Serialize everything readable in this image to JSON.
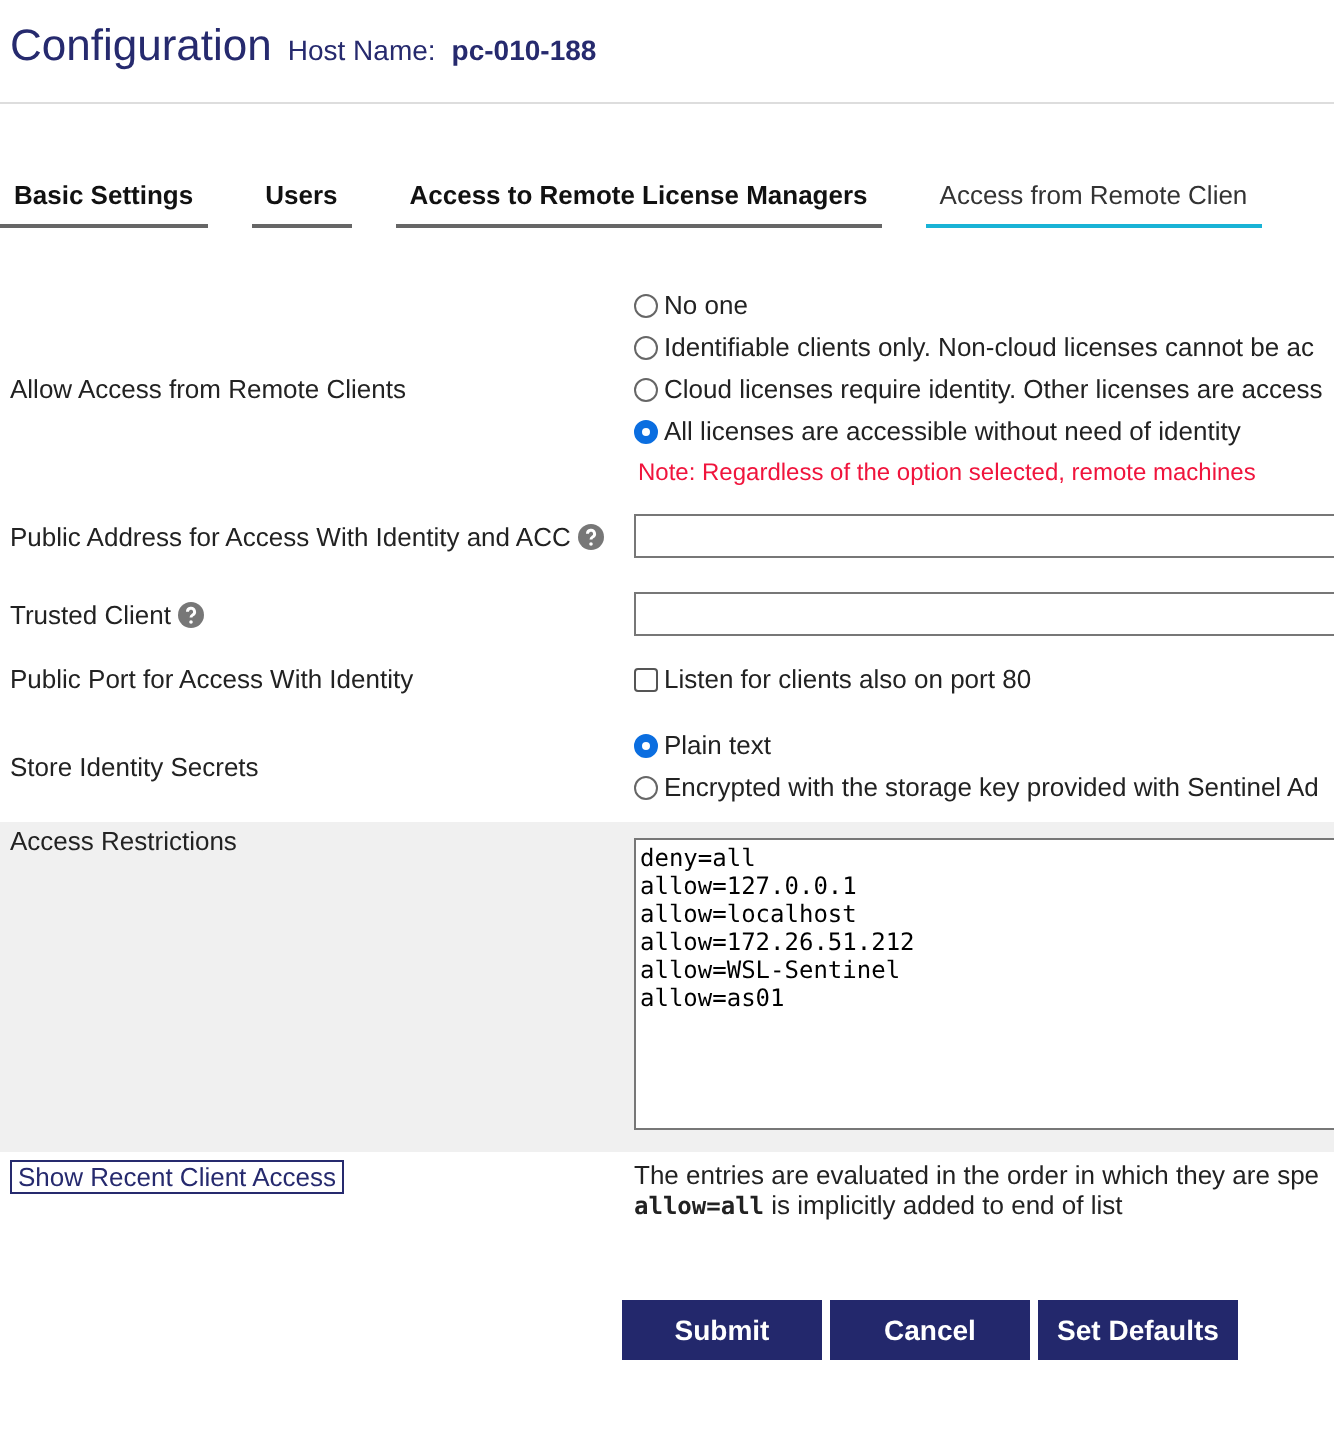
{
  "header": {
    "title": "Configuration",
    "host_label": "Host Name:",
    "host_name": "pc-010-188"
  },
  "tabs": [
    {
      "label": "Basic Settings",
      "selected": false
    },
    {
      "label": "Users",
      "selected": false
    },
    {
      "label": "Access to Remote License Managers",
      "selected": false
    },
    {
      "label": "Access from Remote Clien",
      "selected": true
    }
  ],
  "allow_access": {
    "label": "Allow Access from Remote Clients",
    "options": [
      {
        "label": "No one",
        "selected": false
      },
      {
        "label": "Identifiable clients only. Non-cloud licenses cannot be ac",
        "selected": false
      },
      {
        "label": "Cloud licenses require identity. Other licenses are access",
        "selected": false
      },
      {
        "label": "All licenses are accessible without need of identity",
        "selected": true
      }
    ],
    "note": "Note: Regardless of the option selected, remote machines"
  },
  "public_address": {
    "label": "Public Address for Access With Identity and ACC",
    "help": true
  },
  "trusted_client": {
    "label": "Trusted Client",
    "help": true
  },
  "public_port": {
    "label": "Public Port for Access With Identity",
    "checkbox": {
      "label": "Listen for clients also on port 80",
      "checked": false
    }
  },
  "store_secrets": {
    "label": "Store Identity Secrets",
    "options": [
      {
        "label": "Plain text",
        "selected": true
      },
      {
        "label": "Encrypted with the storage key provided with Sentinel Ad",
        "selected": false
      }
    ]
  },
  "access_restrictions": {
    "label": "Access Restrictions",
    "lines": [
      "deny=all",
      "allow=127.0.0.1",
      "allow=localhost",
      "allow=172.26.51.212",
      "allow=WSL-Sentinel",
      "allow=as01"
    ]
  },
  "recent_button": "Show Recent Client Access",
  "hint": {
    "text": "The entries are evaluated in the order in which they are spe",
    "code": "allow=all",
    "rest": "is implicitly added to end of list"
  },
  "buttons": [
    "Submit",
    "Cancel",
    "Set Defaults"
  ]
}
